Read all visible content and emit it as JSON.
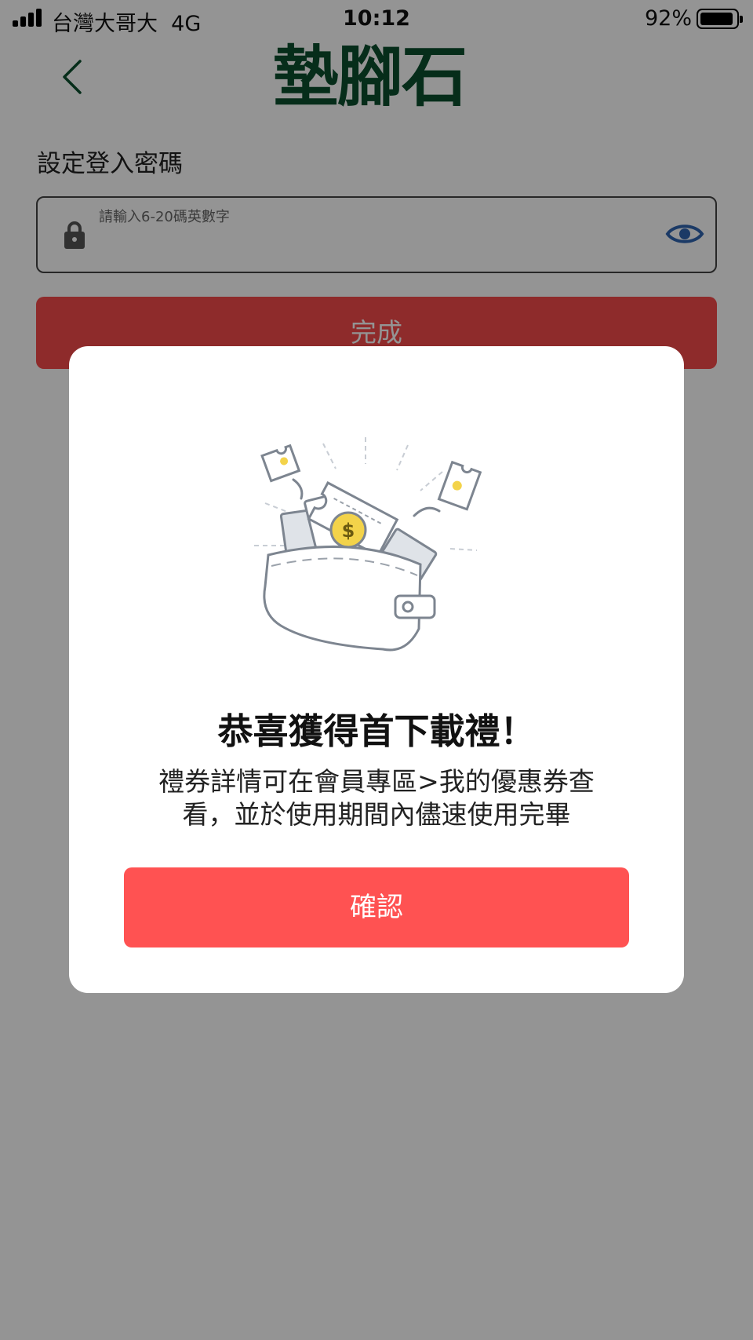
{
  "status_bar": {
    "carrier": "台灣大哥大",
    "network": "4G",
    "time": "10:12",
    "battery": "92%"
  },
  "header": {
    "logo_text": "墊腳石",
    "back_icon": "chevron-left-icon",
    "logo_color": "#0b4f2e"
  },
  "form": {
    "title": "設定登入密碼",
    "password_placeholder": "請輸入6-20碼英數字",
    "password_value": "",
    "lock_icon": "lock-icon",
    "eye_icon": "eye-icon",
    "eye_color": "#2f64b0",
    "done_label": "完成",
    "done_color": "#f54a4a"
  },
  "dialog": {
    "illustration": "wallet-coupons-illustration",
    "title": "恭喜獲得首下載禮！",
    "message_line1": "禮券詳情可在會員專區>我的優惠券查",
    "message_line2": "看，並於使用期間內儘速使用完畢",
    "confirm_label": "確認",
    "confirm_color": "#ff5252"
  }
}
